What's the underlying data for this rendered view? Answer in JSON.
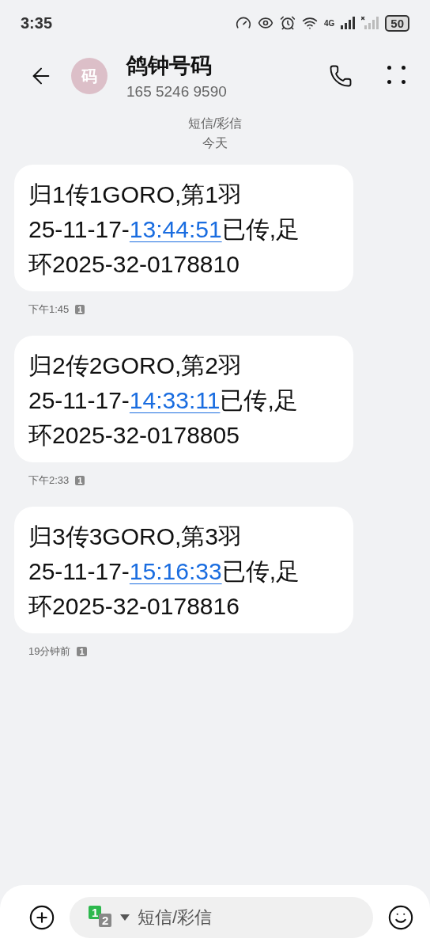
{
  "status_bar": {
    "time": "3:35",
    "battery": "50",
    "network": "4G"
  },
  "header": {
    "avatar": "码",
    "name": "鸽钟号码",
    "number": "165 5246 9590"
  },
  "thread_info": {
    "type": "短信/彩信",
    "date": "今天"
  },
  "messages": [
    {
      "line_1": "归1传1GORO,第1羽",
      "prefix": "25-11-17-",
      "time_link": "13:44:51",
      "suffix": "已传,足",
      "line_3": "环2025-32-0178810",
      "timestamp": "下午1:45",
      "sim": "1"
    },
    {
      "line_1": "归2传2GORO,第2羽",
      "prefix": "25-11-17-",
      "time_link": "14:33:11",
      "suffix": "已传,足",
      "line_3": "环2025-32-0178805",
      "timestamp": "下午2:33",
      "sim": "1"
    },
    {
      "line_1": "归3传3GORO,第3羽",
      "prefix": "25-11-17-",
      "time_link": "15:16:33",
      "suffix": "已传,足",
      "line_3": "环2025-32-0178816",
      "timestamp": "19分钟前",
      "sim": "1"
    }
  ],
  "composer": {
    "sim_primary": "1",
    "sim_secondary": "2",
    "placeholder": "短信/彩信"
  }
}
